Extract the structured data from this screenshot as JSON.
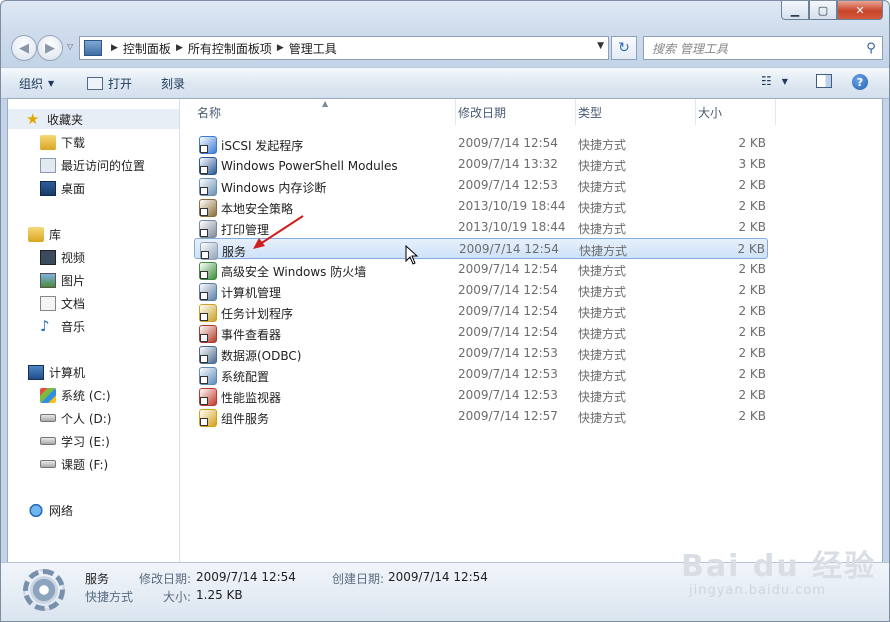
{
  "window": {
    "caption_buttons": [
      "minimize",
      "maximize",
      "close"
    ]
  },
  "address_bar": {
    "breadcrumbs": [
      "控制面板",
      "所有控制面板项",
      "管理工具"
    ]
  },
  "search": {
    "placeholder": "搜索 管理工具"
  },
  "toolbar": {
    "organize_label": "组织",
    "open_label": "打开",
    "burn_label": "刻录"
  },
  "sidebar": {
    "favorites": {
      "label": "收藏夹",
      "items": [
        "下载",
        "最近访问的位置",
        "桌面"
      ]
    },
    "libraries": {
      "label": "库",
      "items": [
        "视频",
        "图片",
        "文档",
        "音乐"
      ]
    },
    "computer": {
      "label": "计算机",
      "items": [
        "系统 (C:)",
        "个人 (D:)",
        "学习 (E:)",
        "课题 (F:)"
      ]
    },
    "network": {
      "label": "网络"
    }
  },
  "columns": [
    "名称",
    "修改日期",
    "类型",
    "大小"
  ],
  "files": [
    {
      "name": "iSCSI 发起程序",
      "date": "2009/7/14 12:54",
      "type": "快捷方式",
      "size": "2 KB",
      "icon_color": "#3a7bd5"
    },
    {
      "name": "Windows PowerShell Modules",
      "date": "2009/7/14 13:32",
      "type": "快捷方式",
      "size": "3 KB",
      "icon_color": "#2b5797"
    },
    {
      "name": "Windows 内存诊断",
      "date": "2009/7/14 12:53",
      "type": "快捷方式",
      "size": "2 KB",
      "icon_color": "#6a8fb5"
    },
    {
      "name": "本地安全策略",
      "date": "2013/10/19 18:44",
      "type": "快捷方式",
      "size": "2 KB",
      "icon_color": "#8a6d3b"
    },
    {
      "name": "打印管理",
      "date": "2013/10/19 18:44",
      "type": "快捷方式",
      "size": "2 KB",
      "icon_color": "#7d8a99"
    },
    {
      "name": "服务",
      "date": "2009/7/14 12:54",
      "type": "快捷方式",
      "size": "2 KB",
      "icon_color": "#8fa3b8",
      "selected": true
    },
    {
      "name": "高级安全 Windows 防火墙",
      "date": "2009/7/14 12:54",
      "type": "快捷方式",
      "size": "2 KB",
      "icon_color": "#3c8d3c"
    },
    {
      "name": "计算机管理",
      "date": "2009/7/14 12:54",
      "type": "快捷方式",
      "size": "2 KB",
      "icon_color": "#5a7fa8"
    },
    {
      "name": "任务计划程序",
      "date": "2009/7/14 12:54",
      "type": "快捷方式",
      "size": "2 KB",
      "icon_color": "#c9a227"
    },
    {
      "name": "事件查看器",
      "date": "2009/7/14 12:54",
      "type": "快捷方式",
      "size": "2 KB",
      "icon_color": "#b23a2a"
    },
    {
      "name": "数据源(ODBC)",
      "date": "2009/7/14 12:53",
      "type": "快捷方式",
      "size": "2 KB",
      "icon_color": "#4b6b8f"
    },
    {
      "name": "系统配置",
      "date": "2009/7/14 12:53",
      "type": "快捷方式",
      "size": "2 KB",
      "icon_color": "#5d8bbd"
    },
    {
      "name": "性能监视器",
      "date": "2009/7/14 12:53",
      "type": "快捷方式",
      "size": "2 KB",
      "icon_color": "#c0392b"
    },
    {
      "name": "组件服务",
      "date": "2009/7/14 12:57",
      "type": "快捷方式",
      "size": "2 KB",
      "icon_color": "#d4a017"
    }
  ],
  "details": {
    "name": "服务",
    "type": "快捷方式",
    "modified_label": "修改日期:",
    "modified_value": "2009/7/14 12:54",
    "created_label": "创建日期:",
    "created_value": "2009/7/14 12:54",
    "size_label": "大小:",
    "size_value": "1.25 KB"
  },
  "watermark": {
    "brand": "Bai du 经验",
    "url": "jingyan.baidu.com"
  }
}
